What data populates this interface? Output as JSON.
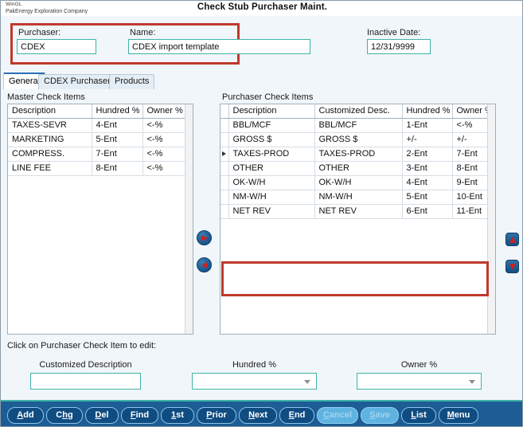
{
  "titlebar": {
    "brand_line1": "WinGL",
    "brand_line2": "PakEnergy Exploration Company",
    "window_title": "Check Stub Purchaser Maint."
  },
  "header": {
    "purchaser_label": "Purchaser:",
    "purchaser_value": "CDEX",
    "name_label": "Name:",
    "name_value": "CDEX import template",
    "inactive_label": "Inactive Date:",
    "inactive_value": "12/31/9999",
    "highlight_color": "#c0392b"
  },
  "tabs": [
    {
      "label": "General",
      "active": true
    },
    {
      "label": "CDEX Purchaser",
      "active": false
    },
    {
      "label": "Products",
      "active": false
    }
  ],
  "master_grid": {
    "title": "Master Check Items",
    "columns": [
      "Description",
      "Hundred %",
      "Owner %"
    ],
    "rows": [
      [
        "TAXES-SEVR",
        "4-Ent",
        "<-%"
      ],
      [
        "MARKETING",
        "5-Ent",
        "<-%"
      ],
      [
        "COMPRESS.",
        "7-Ent",
        "<-%"
      ],
      [
        "LINE FEE",
        "8-Ent",
        "<-%"
      ]
    ]
  },
  "purchaser_grid": {
    "title": "Purchaser Check Items",
    "columns": [
      "Description",
      "Customized Desc.",
      "Hundred %",
      "Owner %"
    ],
    "rows": [
      {
        "cells": [
          "BBL/MCF",
          "BBL/MCF",
          "1-Ent",
          "<-%"
        ],
        "marker": false,
        "highlight": false
      },
      {
        "cells": [
          "GROSS $",
          "GROSS $",
          "+/-",
          "+/-"
        ],
        "marker": false,
        "highlight": false
      },
      {
        "cells": [
          "TAXES-PROD",
          "TAXES-PROD",
          "2-Ent",
          "7-Ent"
        ],
        "marker": true,
        "highlight": false
      },
      {
        "cells": [
          "OTHER",
          "OTHER",
          "3-Ent",
          "8-Ent"
        ],
        "marker": false,
        "highlight": false
      },
      {
        "cells": [
          "OK-W/H",
          "OK-W/H",
          "4-Ent",
          "9-Ent"
        ],
        "marker": false,
        "highlight": true
      },
      {
        "cells": [
          "NM-W/H",
          "NM-W/H",
          "5-Ent",
          "10-Ent"
        ],
        "marker": false,
        "highlight": true
      },
      {
        "cells": [
          "NET REV",
          "NET REV",
          "6-Ent",
          "11-Ent"
        ],
        "marker": false,
        "highlight": false
      }
    ]
  },
  "transfer_buttons": {
    "move_right": "move-right-arrow",
    "move_left": "move-left-arrow",
    "move_up": "move-up-arrow",
    "move_down": "move-down-arrow"
  },
  "edit_section": {
    "hint": "Click on Purchaser Check Item to edit:",
    "custdesc_label": "Customized Description",
    "custdesc_value": "",
    "hundred_label": "Hundred %",
    "hundred_value": "",
    "owner_label": "Owner %",
    "owner_value": ""
  },
  "buttonbar": [
    {
      "label": "Add",
      "accel": "A",
      "disabled": false
    },
    {
      "label": "Chg",
      "accel": "h",
      "disabled": false
    },
    {
      "label": "Del",
      "accel": "D",
      "disabled": false
    },
    {
      "label": "Find",
      "accel": "F",
      "disabled": false
    },
    {
      "label": "1st",
      "accel": "1",
      "disabled": false
    },
    {
      "label": "Prior",
      "accel": "P",
      "disabled": false
    },
    {
      "label": "Next",
      "accel": "N",
      "disabled": false
    },
    {
      "label": "End",
      "accel": "E",
      "disabled": false
    },
    {
      "label": "Cancel",
      "accel": "C",
      "disabled": true
    },
    {
      "label": "Save",
      "accel": "S",
      "disabled": true
    },
    {
      "label": "List",
      "accel": "L",
      "disabled": false
    },
    {
      "label": "Menu",
      "accel": "M",
      "disabled": false
    }
  ]
}
